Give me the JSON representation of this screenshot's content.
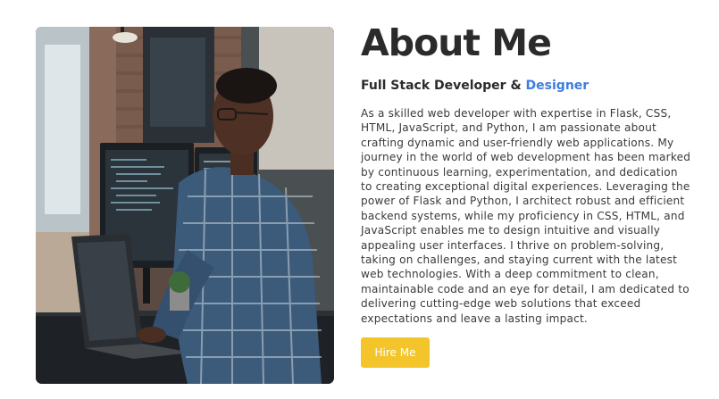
{
  "about": {
    "title": "About Me",
    "subtitle_prefix": "Full Stack Developer & ",
    "subtitle_accent": "Designer",
    "bio": "As a skilled web developer with expertise in Flask, CSS, HTML, JavaScript, and Python, I am passionate about crafting dynamic and user-friendly web applications. My journey in the world of web development has been marked by continuous learning, experimentation, and dedication to creating exceptional digital experiences. Leveraging the power of Flask and Python, I architect robust and efficient backend systems, while my proficiency in CSS, HTML, and JavaScript enables me to design intuitive and visually appealing user interfaces. I thrive on problem-solving, taking on challenges, and staying current with the latest web technologies. With a deep commitment to clean, maintainable code and an eye for detail, I am dedicated to delivering cutting-edge web solutions that exceed expectations and leave a lasting impact.",
    "cta_label": "Hire Me"
  },
  "colors": {
    "accent": "#3d7dde",
    "button": "#f3c52a",
    "heading": "#2b2b2b",
    "body_text": "#3a3a3a"
  }
}
